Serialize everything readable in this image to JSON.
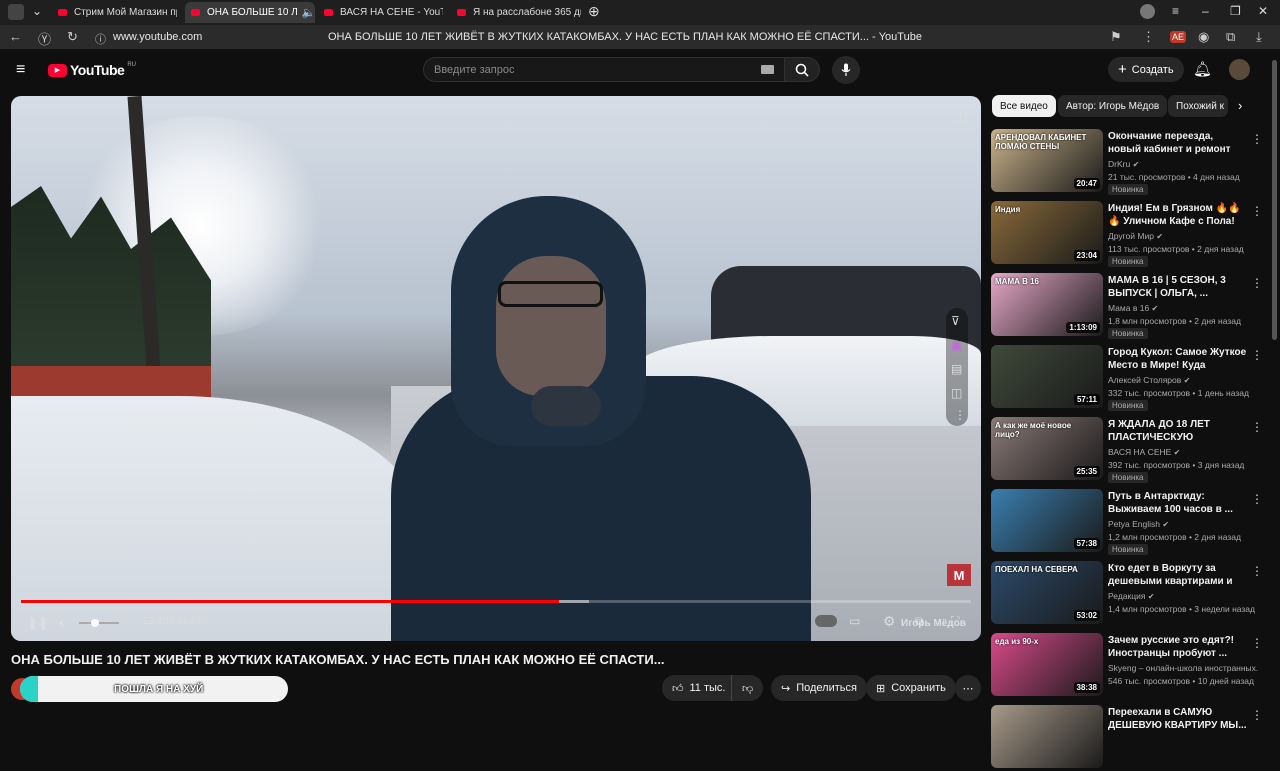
{
  "browser": {
    "tabs": [
      {
        "label": "Стрим Мой Магазин про",
        "active": false
      },
      {
        "label": "ОНА БОЛЬШЕ 10 Л",
        "active": true
      },
      {
        "label": "ВАСЯ НА СЕНЕ - YouTube",
        "active": false
      },
      {
        "label": "Я на расслабоне 365 дней",
        "active": false
      }
    ],
    "url": "www.youtube.com",
    "page_title": "ОНА БОЛЬШЕ 10 ЛЕТ ЖИВЁТ В ЖУТКИХ КАТАКОМБАХ. У НАС ЕСТЬ ПЛАН КАК МОЖНО ЕЁ СПАСТИ... - YouTube",
    "extension_badge": "AE"
  },
  "header": {
    "logo_text": "YouTube",
    "logo_region": "RU",
    "search_placeholder": "Введите запрос",
    "create_label": "Создать"
  },
  "player": {
    "current_time": "23:40",
    "duration": "41:47",
    "played_fraction": 0.566,
    "buffered_fraction": 0.598,
    "watermark": "Игорь Мёдов"
  },
  "video": {
    "title": "ОНА БОЛЬШЕ 10 ЛЕТ ЖИВЁТ В ЖУТКИХ КАТАКОМБАХ. У НАС ЕСТЬ ПЛАН КАК МОЖНО ЕЁ СПАСТИ...",
    "overlay_text": "ПОШЛА Я НА ХУЙ",
    "likes": "11 тыс.",
    "share_label": "Поделиться",
    "save_label": "Сохранить"
  },
  "sidebar": {
    "chips": [
      "Все видео",
      "Автор: Игорь Мёдов",
      "Похожий к"
    ],
    "items": [
      {
        "title": "Окончание переезда, новый кабинет и ремонт",
        "channel": "DrKru",
        "meta": "21 тыс. просмотров • 4 дня назад",
        "badge": "Новинка",
        "duration": "20:47",
        "thumb_text": "АРЕНДОВАЛ КАБИНЕТ ЛОМАЮ СТЕНЫ",
        "color": "#c9b28a"
      },
      {
        "title": "Индия! Ем в Грязном 🔥🔥🔥 Уличном Кафе с Пола! За эт...",
        "channel": "Другой Мир",
        "meta": "113 тыс. просмотров • 2 дня назад",
        "badge": "Новинка",
        "duration": "23:04",
        "thumb_text": "Индия",
        "color": "#8a6a3a"
      },
      {
        "title": "МАМА В 16 | 5 СЕЗОН, 3 ВЫПУСК | ОЛЬГА, ...",
        "channel": "Мама в 16",
        "meta": "1,8 млн просмотров • 2 дня назад",
        "badge": "Новинка",
        "duration": "1:13:09",
        "thumb_text": "МАМА В 16",
        "color": "#e7a8c8"
      },
      {
        "title": "Город Кукол: Самое Жуткое Место в Мире! Куда Пропали...",
        "channel": "Алексей Столяров",
        "meta": "332 тыс. просмотров • 1 день назад",
        "badge": "Новинка",
        "duration": "57:11",
        "thumb_text": "",
        "color": "#3f4a3a"
      },
      {
        "title": "Я ЖДАЛА ДО 18 ЛЕТ ПЛАСТИЧЕСКУЮ ОПЕРАЦИ...",
        "channel": "ВАСЯ НА СЕНЕ",
        "meta": "392 тыс. просмотров • 3 дня назад",
        "badge": "Новинка",
        "duration": "25:35",
        "thumb_text": "А как же моё новое лицо?",
        "color": "#8b7a78"
      },
      {
        "title": "Путь в Антарктиду: Выживаем 100 часов в ...",
        "channel": "Petya English",
        "meta": "1,2 млн просмотров • 2 дня назад",
        "badge": "Новинка",
        "duration": "57:38",
        "thumb_text": "",
        "color": "#3a7fb0"
      },
      {
        "title": "Кто едет в Воркуту за дешевыми квартирами и ка...",
        "channel": "Редакция",
        "meta": "1,4 млн просмотров • 3 недели назад",
        "badge": "",
        "duration": "53:02",
        "thumb_text": "ПОЕХАЛ НА СЕВЕРА",
        "color": "#2b4a6a"
      },
      {
        "title": "Зачем русские это едят?! Иностранцы пробуют ...",
        "channel": "Skyeng – онлайн-школа иностранных...",
        "meta": "546 тыс. просмотров • 10 дней назад",
        "badge": "",
        "duration": "38:38",
        "thumb_text": "еда из 90-х",
        "color": "#d94a8a"
      },
      {
        "title": "Переехали в САМУЮ ДЕШЕВУЮ КВАРТИРУ МЫ...",
        "channel": "",
        "meta": "",
        "badge": "",
        "duration": "",
        "thumb_text": "",
        "color": "#a89a8a"
      }
    ]
  }
}
